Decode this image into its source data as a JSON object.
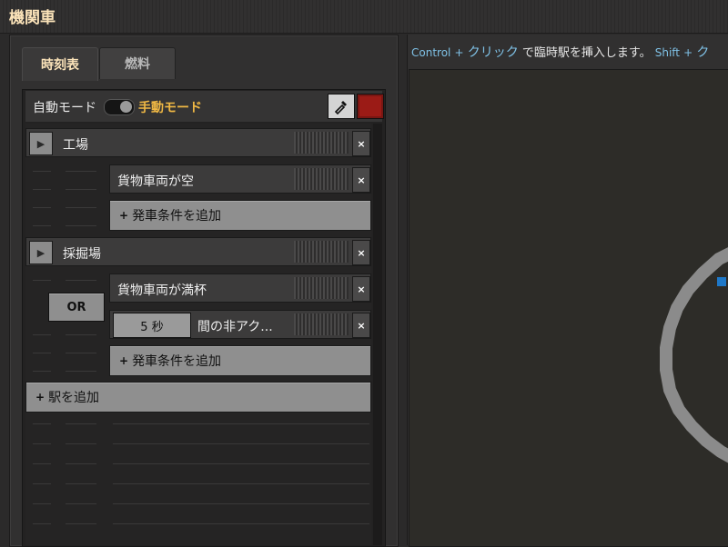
{
  "window": {
    "title": "機関車"
  },
  "tabs": [
    {
      "label": "時刻表",
      "active": true
    },
    {
      "label": "燃料",
      "active": false
    }
  ],
  "mode": {
    "auto_label": "自動モード",
    "manual_label": "手動モード",
    "manual_selected": true
  },
  "colors": {
    "train_color": "#9b1b16",
    "accent": "#f0b844",
    "hint_key": "#7fc1e6"
  },
  "stations": [
    {
      "name": "工場",
      "conditions": [
        "貨物車両が空"
      ]
    },
    {
      "name": "採掘場",
      "conditions": [
        "貨物車両が満杯",
        "間の非アク..."
      ],
      "connector": "OR",
      "time_value": "5 秒"
    }
  ],
  "buttons": {
    "add_condition": "発車条件を追加",
    "add_station": "駅を追加",
    "plus": "+",
    "close": "×"
  },
  "hint": {
    "key1": "Control",
    "plus": "+",
    "click": "クリック",
    "text": "で臨時駅を挿入します。",
    "key2": "Shift",
    "click_trunc": "ク"
  },
  "icons": [
    "play-icon",
    "pipette-icon",
    "close-icon",
    "toggle-switch"
  ]
}
